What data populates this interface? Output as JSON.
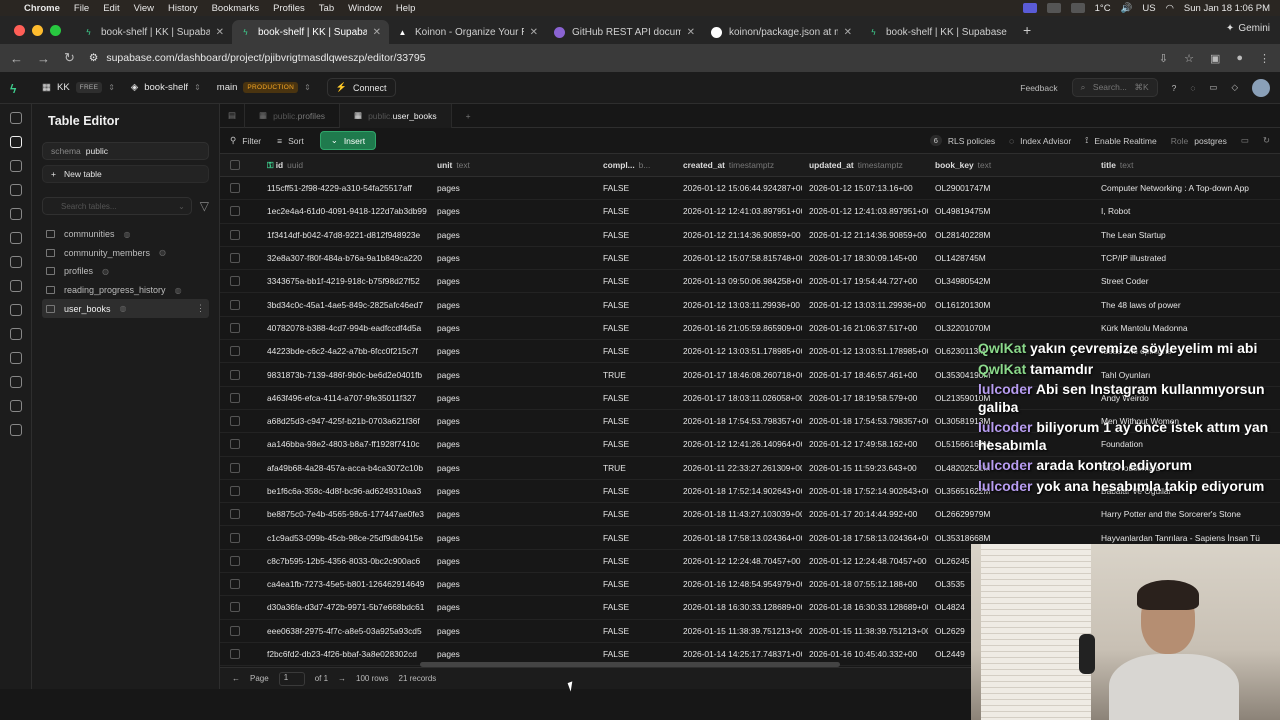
{
  "macbar": {
    "app": "Chrome",
    "menus": [
      "File",
      "Edit",
      "View",
      "History",
      "Bookmarks",
      "Profiles",
      "Tab",
      "Window",
      "Help"
    ],
    "temp": "1°C",
    "lang": "US",
    "datetime": "Sun Jan 18  1:06 PM"
  },
  "tabs": [
    {
      "title": "book-shelf | KK | Supabase",
      "icon": "supabase-icon",
      "active": false
    },
    {
      "title": "book-shelf | KK | Supabase",
      "icon": "supabase-icon",
      "active": true
    },
    {
      "title": "Koinon - Organize Your Readi",
      "icon": "koinon-icon",
      "active": false
    },
    {
      "title": "GitHub REST API documentat",
      "icon": "github-docs-icon",
      "active": false
    },
    {
      "title": "koinon/package.json at main",
      "icon": "github-icon",
      "active": false
    },
    {
      "title": "book-shelf | KK | Supabase",
      "icon": "supabase-icon",
      "active": false
    }
  ],
  "gemini": "Gemini",
  "url": "supabase.com/dashboard/project/pjibvrigtmasdlqweszp/editor/33795",
  "sb": {
    "org": "KK",
    "org_plan": "FREE",
    "project": "book-shelf",
    "branch": "main",
    "branch_tag": "PRODUCTION",
    "connect": "Connect",
    "feedback": "Feedback",
    "search": "Search...",
    "search_kbd": "⌘K"
  },
  "sidebar": {
    "title": "Table Editor",
    "schema_label": "schema",
    "schema": "public",
    "new_table": "New table",
    "search_placeholder": "Search tables...",
    "tables": [
      "communities",
      "community_members",
      "profiles",
      "reading_progress_history",
      "user_books"
    ]
  },
  "content_tabs": [
    {
      "schema": "public.",
      "name": "profiles",
      "active": false
    },
    {
      "schema": "public.",
      "name": "user_books",
      "active": true
    }
  ],
  "toolbar": {
    "filter": "Filter",
    "sort": "Sort",
    "insert": "Insert",
    "rls_count": "6",
    "rls": "RLS policies",
    "index_advisor": "Index Advisor",
    "realtime": "Enable Realtime",
    "role_label": "Role",
    "role": "postgres"
  },
  "columns": [
    {
      "name": "id",
      "type": "uuid"
    },
    {
      "name": "unit",
      "type": "text"
    },
    {
      "name": "compl...",
      "type": "b..."
    },
    {
      "name": "created_at",
      "type": "timestamptz"
    },
    {
      "name": "updated_at",
      "type": "timestamptz"
    },
    {
      "name": "book_key",
      "type": "text"
    },
    {
      "name": "title",
      "type": "text"
    }
  ],
  "rows": [
    [
      "115cff51-2f98-4229-a310-54fa25517aff",
      "pages",
      "FALSE",
      "2026-01-12 15:06:44.924287+00",
      "2026-01-12 15:07:13.16+00",
      "OL29001747M",
      "Computer Networking : A Top-down App"
    ],
    [
      "1ec2e4a4-61d0-4091-9418-122d7ab3db99",
      "pages",
      "FALSE",
      "2026-01-12 12:41:03.897951+00",
      "2026-01-12 12:41:03.897951+00",
      "OL49819475M",
      "I, Robot"
    ],
    [
      "1f3414df-b042-47d8-9221-d812f948923e",
      "pages",
      "FALSE",
      "2026-01-12 21:14:36.90859+00",
      "2026-01-12 21:14:36.90859+00",
      "OL28140228M",
      "The Lean Startup"
    ],
    [
      "32e8a307-f80f-484a-b76a-9a1b849ca220",
      "pages",
      "FALSE",
      "2026-01-12 15:07:58.815748+00",
      "2026-01-17 18:30:09.145+00",
      "OL1428745M",
      "TCP/IP illustrated"
    ],
    [
      "3343675a-bb1f-4219-918c-b75f98d27f52",
      "pages",
      "FALSE",
      "2026-01-13 09:50:06.984258+00",
      "2026-01-17 19:54:44.727+00",
      "OL34980542M",
      "Street Coder"
    ],
    [
      "3bd34c0c-45a1-4ae5-849c-2825afc46ed7",
      "pages",
      "FALSE",
      "2026-01-12 13:03:11.29936+00",
      "2026-01-12 13:03:11.29936+00",
      "OL16120130M",
      "The 48 laws of power"
    ],
    [
      "40782078-b388-4cd7-994b-eadfccdf4d5a",
      "pages",
      "FALSE",
      "2026-01-16 21:05:59.865909+00",
      "2026-01-16 21:06:37.517+00",
      "OL32201070M",
      "Kürk Mantolu Madonna"
    ],
    [
      "44223bde-c6c2-4a22-a7bb-6fcc0f215c7f",
      "pages",
      "FALSE",
      "2026-01-12 13:03:51.178985+00",
      "2026-01-12 13:03:51.178985+00",
      "OL6230113M",
      "Ideas and opinions"
    ],
    [
      "9831873b-7139-486f-9b0c-be6d2e0401fb",
      "pages",
      "TRUE",
      "2026-01-17 18:46:08.260718+00",
      "2026-01-17 18:46:57.461+00",
      "OL35304190M",
      "Tahl Oyunları"
    ],
    [
      "a463f496-efca-4114-a707-9fe35011f327",
      "pages",
      "FALSE",
      "2026-01-17 18:03:11.026058+00",
      "2026-01-17 18:19:58.579+00",
      "OL21359010M",
      "Andy Weirdo"
    ],
    [
      "a68d25d3-c947-425f-b21b-0703a621f36f",
      "pages",
      "FALSE",
      "2026-01-18 17:54:53.798357+00",
      "2026-01-18 17:54:53.798357+00",
      "OL30581913M",
      "Men Without Women"
    ],
    [
      "aa146bba-98e2-4803-b8a7-ff1928f7410c",
      "pages",
      "FALSE",
      "2026-01-12 12:41:26.140964+00",
      "2026-01-12 17:49:58.162+00",
      "OL51566164M",
      "Foundation"
    ],
    [
      "afa49b68-4a28-457a-acca-b4ca3072c10b",
      "pages",
      "TRUE",
      "2026-01-11 22:33:27.261309+00",
      "2026-01-15 11:59:23.643+00",
      "OL48202521M",
      "The Housemaid"
    ],
    [
      "be1f6c6a-358c-4d8f-bc96-ad6249310aa3",
      "pages",
      "FALSE",
      "2026-01-18 17:52:14.902643+00",
      "2026-01-18 17:52:14.902643+00",
      "OL35651622M",
      "Babalar Ve Oğullar"
    ],
    [
      "be8875c0-7e4b-4565-98c6-177447ae0fe3",
      "pages",
      "FALSE",
      "2026-01-18 11:43:27.103039+00",
      "2026-01-17 20:14:44.992+00",
      "OL26629979M",
      "Harry Potter and the Sorcerer's Stone"
    ],
    [
      "c1c9ad53-099b-45cb-98ce-25df9db9415e",
      "pages",
      "FALSE",
      "2026-01-18 17:58:13.024364+00",
      "2026-01-18 17:58:13.024364+00",
      "OL35318668M",
      "Hayvanlardan Tanrılara - Sapiens İnsan Tü"
    ],
    [
      "c8c7b595-12b5-4356-8033-0bc2c900ac6",
      "pages",
      "FALSE",
      "2026-01-12 12:24:48.70457+00",
      "2026-01-12 12:24:48.70457+00",
      "OL26245",
      ""
    ],
    [
      "ca4ea1fb-7273-45e5-b801-126462914649",
      "pages",
      "FALSE",
      "2026-01-16 12:48:54.954979+00",
      "2026-01-18 07:55:12.188+00",
      "OL3535",
      ""
    ],
    [
      "d30a36fa-d3d7-472b-9971-5b7e668bdc61",
      "pages",
      "FALSE",
      "2026-01-18 16:30:33.128689+00",
      "2026-01-18 16:30:33.128689+00",
      "OL4824",
      ""
    ],
    [
      "eee0638f-2975-4f7c-a8e5-03a925a93cd5",
      "pages",
      "FALSE",
      "2026-01-15 11:38:39.751213+00",
      "2026-01-15 11:38:39.751213+00",
      "OL2629",
      ""
    ],
    [
      "f2bc6fd2-db23-4f26-bbaf-3a8e028302cd",
      "pages",
      "FALSE",
      "2026-01-14 14:25:17.748371+00",
      "2026-01-16 10:45:40.332+00",
      "OL2449",
      ""
    ]
  ],
  "footer": {
    "page_label": "Page",
    "page": "1",
    "of": "of 1",
    "rows": "100 rows",
    "records": "21 records"
  },
  "chat": [
    {
      "user": "QwlKat",
      "text": "yakın çevremize söyleyelim mi abi"
    },
    {
      "user": "QwlKat",
      "text": "tamamdır"
    },
    {
      "user": "lulcoder",
      "text": "Abi sen Instagram kullanmıyorsun galiba"
    },
    {
      "user": "lulcoder",
      "text": "biliyorum 1 ay önce istek attım yan hesabımla"
    },
    {
      "user": "lulcoder",
      "text": "arada kontrol ediyorum"
    },
    {
      "user": "lulcoder",
      "text": "yok ana hesabımla takip ediyorum"
    }
  ]
}
